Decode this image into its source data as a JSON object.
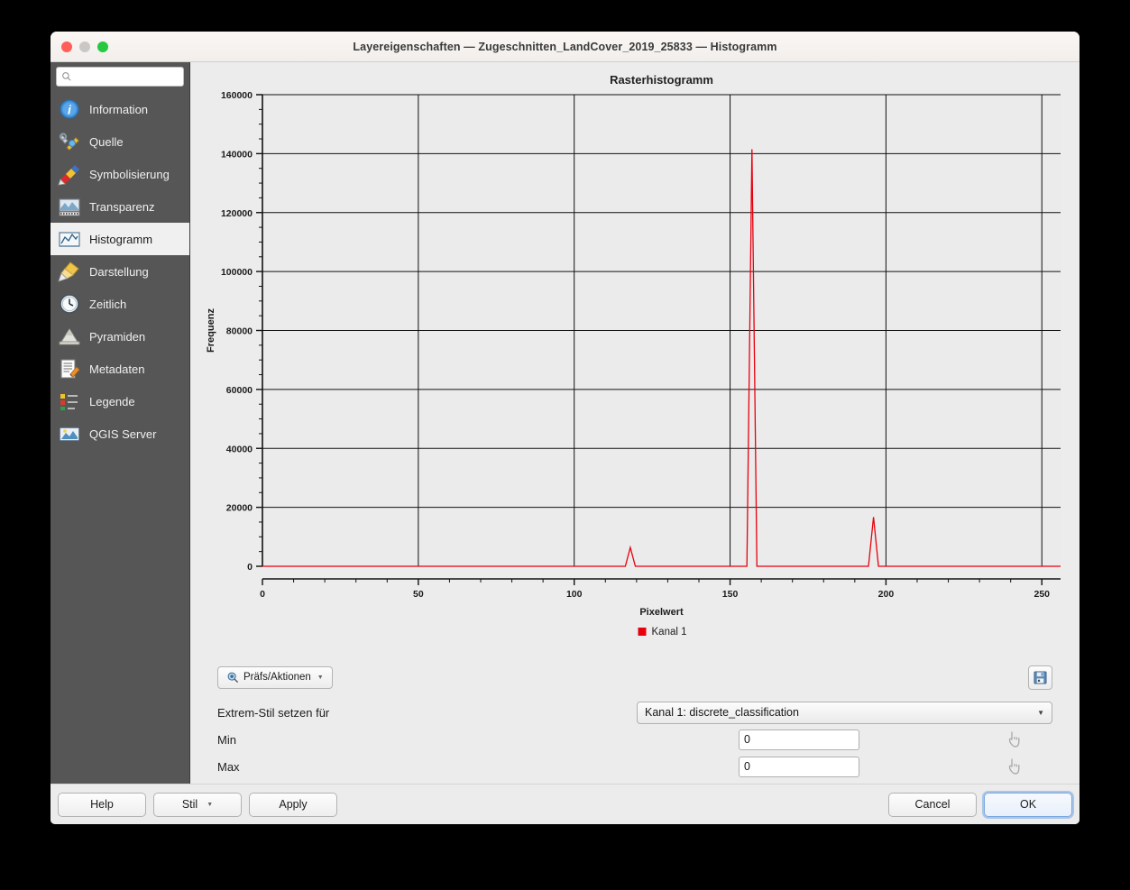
{
  "window": {
    "title": "Layereigenschaften — Zugeschnitten_LandCover_2019_25833 — Histogramm",
    "traffic": {
      "close": "close-button",
      "minimize": "minimize-button",
      "zoom": "zoom-button"
    }
  },
  "sidebar": {
    "search": {
      "value": "",
      "placeholder": ""
    },
    "items": [
      {
        "label": "Information",
        "icon": "information-icon",
        "selected": false
      },
      {
        "label": "Quelle",
        "icon": "source-icon",
        "selected": false
      },
      {
        "label": "Symbolisierung",
        "icon": "symbology-icon",
        "selected": false
      },
      {
        "label": "Transparenz",
        "icon": "transparency-icon",
        "selected": false
      },
      {
        "label": "Histogramm",
        "icon": "histogram-icon",
        "selected": true
      },
      {
        "label": "Darstellung",
        "icon": "rendering-icon",
        "selected": false
      },
      {
        "label": "Zeitlich",
        "icon": "temporal-icon",
        "selected": false
      },
      {
        "label": "Pyramiden",
        "icon": "pyramids-icon",
        "selected": false
      },
      {
        "label": "Metadaten",
        "icon": "metadata-icon",
        "selected": false
      },
      {
        "label": "Legende",
        "icon": "legend-icon",
        "selected": false
      },
      {
        "label": "QGIS Server",
        "icon": "qgis-server-icon",
        "selected": false
      }
    ]
  },
  "toolbar": {
    "prefs_label": "Präfs/Aktionen",
    "prefs_icon": "magnifier-settings-icon",
    "save_icon": "floppy-save-icon"
  },
  "form": {
    "extremes_label": "Extrem-Stil setzen für",
    "band_select": {
      "value": "Kanal 1: discrete_classification",
      "options": [
        "Kanal 1: discrete_classification"
      ]
    },
    "min_label": "Min",
    "min_value": "0",
    "max_label": "Max",
    "max_value": "0",
    "pick_icon": "pointer-pick-icon"
  },
  "footer": {
    "help": "Help",
    "style": "Stil",
    "apply": "Apply",
    "cancel": "Cancel",
    "ok": "OK"
  },
  "chart_data": {
    "type": "line",
    "title": "Rasterhistogramm",
    "xlabel": "Pixelwert",
    "ylabel": "Frequenz",
    "xlim": [
      0,
      256
    ],
    "ylim": [
      0,
      160000
    ],
    "xticks": [
      0,
      50,
      100,
      150,
      200,
      250
    ],
    "yticks": [
      0,
      20000,
      40000,
      60000,
      80000,
      100000,
      120000,
      140000,
      160000
    ],
    "xminor_step": 10,
    "yminor_step": 5000,
    "grid": true,
    "legend": {
      "position": "bottom",
      "entries": [
        {
          "name": "Kanal 1",
          "color": "#e8000d"
        }
      ]
    },
    "series": [
      {
        "name": "Kanal 1",
        "color": "#e8000d",
        "peaks": [
          {
            "x": 118,
            "y": 6400
          },
          {
            "x": 157,
            "y": 141500
          },
          {
            "x": 196,
            "y": 16700
          }
        ],
        "baseline": 0
      }
    ]
  }
}
